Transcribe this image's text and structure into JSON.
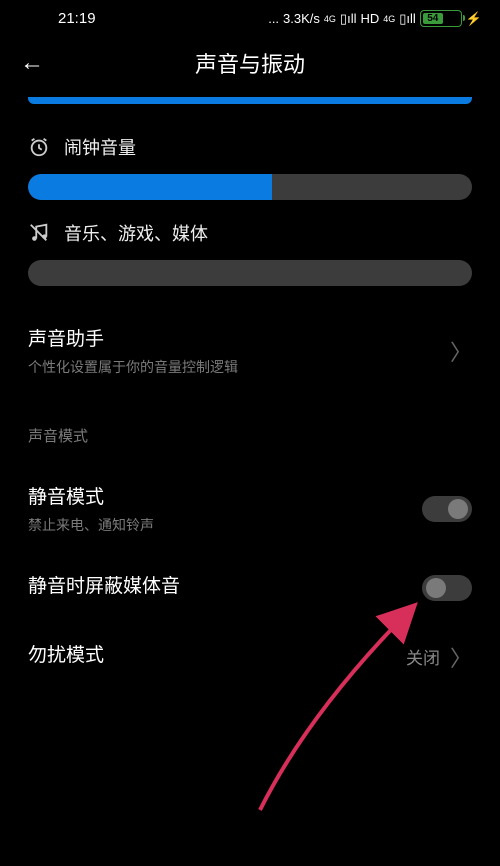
{
  "status": {
    "time": "21:19",
    "dots": "...",
    "speed": "3.3K/s",
    "net1": "4G",
    "signal1": "▯ıll",
    "hd": "HD",
    "net2": "4G",
    "signal2": "▯ıll",
    "battery_pct": "54"
  },
  "header": {
    "title": "声音与振动",
    "back": "←"
  },
  "sliders": {
    "alarm": {
      "label": "闹钟音量",
      "percent": 55
    },
    "media": {
      "label": "音乐、游戏、媒体",
      "percent": 0
    }
  },
  "sound_assistant": {
    "title": "声音助手",
    "subtitle": "个性化设置属于你的音量控制逻辑"
  },
  "category": {
    "sound_mode": "声音模式"
  },
  "silent": {
    "title": "静音模式",
    "subtitle": "禁止来电、通知铃声"
  },
  "mute_media": {
    "title": "静音时屏蔽媒体音"
  },
  "dnd": {
    "title": "勿扰模式",
    "value": "关闭"
  },
  "glyphs": {
    "chevron": "〉",
    "bolt": "⚡"
  }
}
